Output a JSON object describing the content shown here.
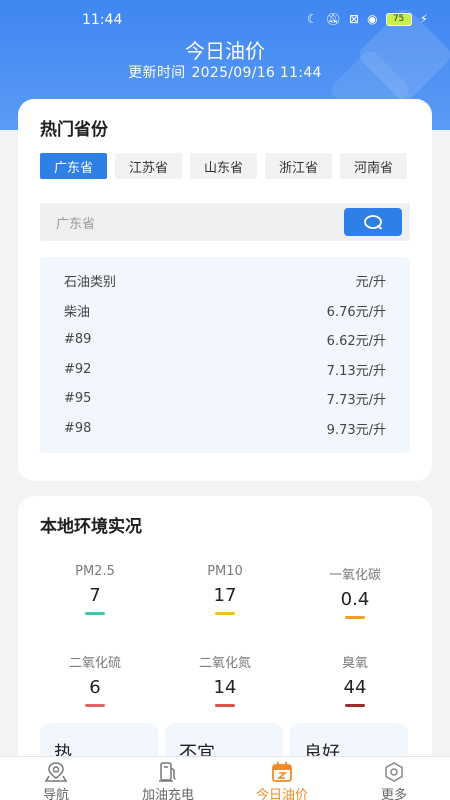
{
  "status": {
    "time": "11:44",
    "battery": "75"
  },
  "header": {
    "title": "今日油价",
    "update_label": "更新时间",
    "update_time": "2025/09/16 11:44"
  },
  "hot": {
    "title": "热门省份",
    "provinces": [
      "广东省",
      "江苏省",
      "山东省",
      "浙江省",
      "河南省"
    ],
    "selected": "广东省",
    "search_placeholder": "广东省"
  },
  "prices": {
    "header": {
      "type": "石油类别",
      "unit": "元/升"
    },
    "rows": [
      {
        "name": "柴油",
        "price": "6.76元/升"
      },
      {
        "name": "#89",
        "price": "6.62元/升"
      },
      {
        "name": "#92",
        "price": "7.13元/升"
      },
      {
        "name": "#95",
        "price": "7.73元/升"
      },
      {
        "name": "#98",
        "price": "9.73元/升"
      }
    ]
  },
  "env": {
    "title": "本地环境实况",
    "items": [
      {
        "label": "PM2.5",
        "value": "7",
        "color": "#3cc9a8"
      },
      {
        "label": "PM10",
        "value": "17",
        "color": "#f2c21c"
      },
      {
        "label": "一氧化碳",
        "value": "0.4",
        "color": "#f39c24"
      },
      {
        "label": "二氧化硫",
        "value": "6",
        "color": "#e06666"
      },
      {
        "label": "二氧化氮",
        "value": "14",
        "color": "#d9534f"
      },
      {
        "label": "臭氧",
        "value": "44",
        "color": "#9b2d2d"
      }
    ],
    "tips": [
      "热",
      "不宜",
      "良好"
    ]
  },
  "tabs": [
    {
      "label": "导航",
      "icon": "location-pin-icon"
    },
    {
      "label": "加油充电",
      "icon": "gas-pump-icon"
    },
    {
      "label": "今日油价",
      "icon": "calendar-icon"
    },
    {
      "label": "更多",
      "icon": "hexagon-icon"
    }
  ],
  "colors": {
    "primary": "#2f80e6",
    "active_tab": "#f08a24"
  }
}
